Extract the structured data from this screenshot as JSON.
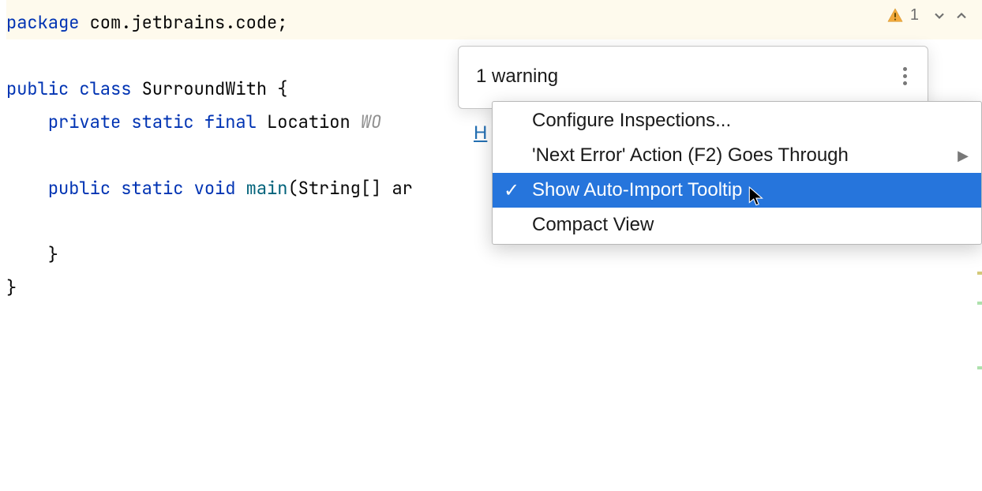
{
  "code": {
    "line1": {
      "package_kw": "package",
      "package_name": " com.jetbrains.code;"
    },
    "line3": {
      "public_kw": "public ",
      "class_kw": "class",
      "class_name": " SurroundWith {"
    },
    "line4": {
      "indent": "    ",
      "private_kw": "private ",
      "static_kw": "static ",
      "final_kw": "final",
      "type": " Location ",
      "var": "WO"
    },
    "line6": {
      "indent": "    ",
      "public_kw": "public ",
      "static_kw": "static ",
      "void_kw": "void ",
      "method": "main",
      "params_open": "(String[] ",
      "param_name": "ar"
    },
    "line8": "    }",
    "line9": "}"
  },
  "inspection": {
    "count": "1"
  },
  "popup": {
    "title": "1 warning",
    "highlight_label": "H"
  },
  "menu": {
    "configure": "Configure Inspections...",
    "next_error": "'Next Error' Action (F2) Goes Through",
    "show_tooltip": "Show Auto-Import Tooltip",
    "compact": "Compact View"
  }
}
